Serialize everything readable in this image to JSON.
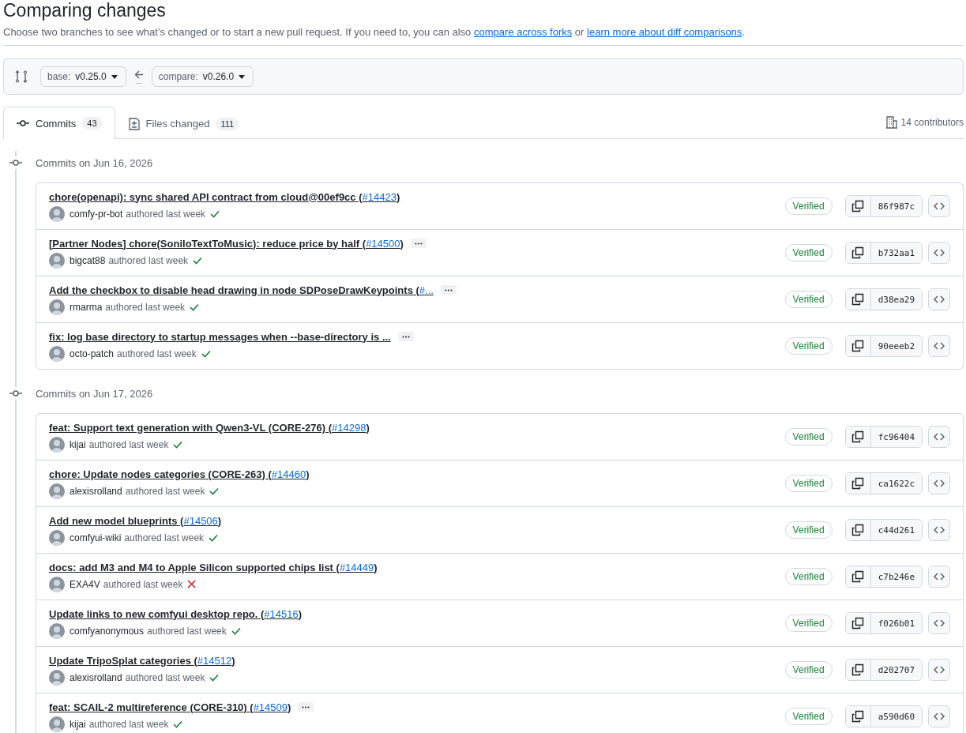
{
  "title": "Comparing changes",
  "description": [
    {
      "kind": "text",
      "text": "Choose two branches to see what’s changed or to start a new pull request. If you need to, you can also "
    },
    {
      "kind": "link",
      "text": "compare across forks"
    },
    {
      "kind": "text",
      "text": " or "
    },
    {
      "kind": "link",
      "text": "learn more about diff comparisons"
    },
    {
      "kind": "text",
      "text": "."
    }
  ],
  "range": {
    "base": {
      "label": "base:",
      "value": "v0.25.0"
    },
    "separator": "...",
    "compare": {
      "label": "compare:",
      "value": "v0.26.0"
    }
  },
  "tabs": [
    {
      "label": "Commits",
      "count": "43",
      "selected": true,
      "kind": "commits"
    },
    {
      "label": "Files changed",
      "count": "111",
      "selected": false,
      "kind": "files"
    }
  ],
  "contributors": "14 contributors",
  "groups": [
    {
      "heading": "Commits on Jun 16, 2026",
      "commits": [
        {
          "title": [
            {
              "kind": "text",
              "text": "chore(openapi): sync shared API contract from cloud@00ef9cc ("
            },
            {
              "kind": "link",
              "text": "#14423"
            },
            {
              "kind": "text",
              "text": ")"
            }
          ],
          "expandable": false,
          "author": "comfy-pr-bot",
          "authored": "authored last week",
          "passed": true,
          "verified": "Verified",
          "sha": "86f987c"
        },
        {
          "title": [
            {
              "kind": "text",
              "text": "[Partner Nodes] chore(SoniloTextToMusic): reduce price by half ("
            },
            {
              "kind": "link",
              "text": "#14500"
            },
            {
              "kind": "text",
              "text": ")"
            }
          ],
          "expandable": true,
          "author": "bigcat88",
          "authored": "authored last week",
          "passed": true,
          "verified": "Verified",
          "sha": "b732aa1"
        },
        {
          "title": [
            {
              "kind": "text",
              "text": "Add the checkbox to disable head drawing in node SDPoseDrawKeypoints ("
            },
            {
              "kind": "link",
              "text": "#..."
            }
          ],
          "expandable": true,
          "author": "rmarma",
          "authored": "authored last week",
          "passed": true,
          "verified": "Verified",
          "sha": "d38ea29"
        },
        {
          "title": [
            {
              "kind": "text",
              "text": "fix: log base directory to startup messages when --base-directory is ..."
            }
          ],
          "expandable": true,
          "author": "octo-patch",
          "authored": "authored last week",
          "passed": true,
          "verified": "Verified",
          "sha": "90eeeb2"
        }
      ]
    },
    {
      "heading": "Commits on Jun 17, 2026",
      "commits": [
        {
          "title": [
            {
              "kind": "text",
              "text": "feat: Support text generation with Qwen3-VL (CORE-276) ("
            },
            {
              "kind": "link",
              "text": "#14298"
            },
            {
              "kind": "text",
              "text": ")"
            }
          ],
          "expandable": false,
          "author": "kijai",
          "authored": "authored last week",
          "passed": true,
          "verified": "Verified",
          "sha": "fc96404"
        },
        {
          "title": [
            {
              "kind": "text",
              "text": "chore: Update nodes categories (CORE-263) ("
            },
            {
              "kind": "link",
              "text": "#14460"
            },
            {
              "kind": "text",
              "text": ")"
            }
          ],
          "expandable": false,
          "author": "alexisrolland",
          "authored": "authored last week",
          "passed": true,
          "verified": "Verified",
          "sha": "ca1622c"
        },
        {
          "title": [
            {
              "kind": "text",
              "text": "Add new model blueprints ("
            },
            {
              "kind": "link",
              "text": "#14506"
            },
            {
              "kind": "text",
              "text": ")"
            }
          ],
          "expandable": false,
          "author": "comfyui-wiki",
          "authored": "authored last week",
          "passed": true,
          "verified": "Verified",
          "sha": "c44d261"
        },
        {
          "title": [
            {
              "kind": "text",
              "text": "docs: add M3 and M4 to Apple Silicon supported chips list ("
            },
            {
              "kind": "link",
              "text": "#14449"
            },
            {
              "kind": "text",
              "text": ")"
            }
          ],
          "expandable": false,
          "author": "EXA4V",
          "authored": "authored last week",
          "passed": false,
          "verified": "Verified",
          "sha": "c7b246e"
        },
        {
          "title": [
            {
              "kind": "text",
              "text": "Update links to new comfyui desktop repo. ("
            },
            {
              "kind": "link",
              "text": "#14516"
            },
            {
              "kind": "text",
              "text": ")"
            }
          ],
          "expandable": false,
          "author": "comfyanonymous",
          "authored": "authored last week",
          "passed": true,
          "verified": "Verified",
          "sha": "f026b01"
        },
        {
          "title": [
            {
              "kind": "text",
              "text": "Update TripoSplat categories ("
            },
            {
              "kind": "link",
              "text": "#14512"
            },
            {
              "kind": "text",
              "text": ")"
            }
          ],
          "expandable": false,
          "author": "alexisrolland",
          "authored": "authored last week",
          "passed": true,
          "verified": "Verified",
          "sha": "d202707"
        },
        {
          "title": [
            {
              "kind": "text",
              "text": "feat: SCAIL-2 multireference (CORE-310) ("
            },
            {
              "kind": "link",
              "text": "#14509"
            },
            {
              "kind": "text",
              "text": ")"
            }
          ],
          "expandable": true,
          "author": "kijai",
          "authored": "authored last week",
          "passed": true,
          "verified": "Verified",
          "sha": "a590d60"
        }
      ]
    }
  ]
}
